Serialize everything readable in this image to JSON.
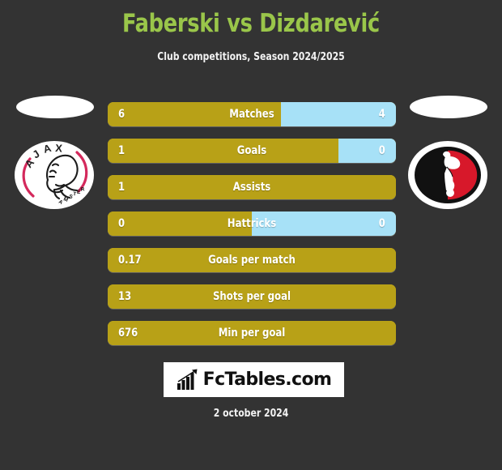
{
  "header": {
    "title": "Faberski vs Dizdarević",
    "subtitle": "Club competitions, Season 2024/2025",
    "title_color": "#9ac64a"
  },
  "teams": {
    "home": {
      "crest_name": "ajax-amsterdam-crest"
    },
    "away": {
      "crest_name": "sparta-rotterdam-crest"
    }
  },
  "colors": {
    "background": "#333333",
    "home_bar": "#b8a117",
    "away_bar": "#a7e1f7",
    "text": "#ffffff"
  },
  "chart_data": {
    "type": "bar",
    "title": "Faberski vs Dizdarević",
    "subtitle": "Club competitions, Season 2024/2025",
    "categories": [
      "Matches",
      "Goals",
      "Assists",
      "Hattricks",
      "Goals per match",
      "Shots per goal",
      "Min per goal"
    ],
    "series": [
      {
        "name": "Faberski",
        "values": [
          "6",
          "1",
          "1",
          "0",
          "0.17",
          "13",
          "676"
        ]
      },
      {
        "name": "Dizdarević",
        "values": [
          "4",
          "0",
          null,
          "0",
          null,
          null,
          null
        ]
      }
    ],
    "legend": "none",
    "grid": false
  },
  "rows": [
    {
      "label": "Matches",
      "left": "6",
      "right": "4",
      "left_pct": 60,
      "has_right": true
    },
    {
      "label": "Goals",
      "left": "1",
      "right": "0",
      "left_pct": 80,
      "has_right": true
    },
    {
      "label": "Assists",
      "left": "1",
      "right": "",
      "left_pct": 100,
      "has_right": false
    },
    {
      "label": "Hattricks",
      "left": "0",
      "right": "0",
      "left_pct": 50,
      "has_right": true
    },
    {
      "label": "Goals per match",
      "left": "0.17",
      "right": "",
      "left_pct": 100,
      "has_right": false
    },
    {
      "label": "Shots per goal",
      "left": "13",
      "right": "",
      "left_pct": 100,
      "has_right": false
    },
    {
      "label": "Min per goal",
      "left": "676",
      "right": "",
      "left_pct": 100,
      "has_right": false
    }
  ],
  "footer": {
    "logo_text": "FcTables.com",
    "logo_icon": "bar-chart-icon",
    "date": "2 october 2024"
  }
}
